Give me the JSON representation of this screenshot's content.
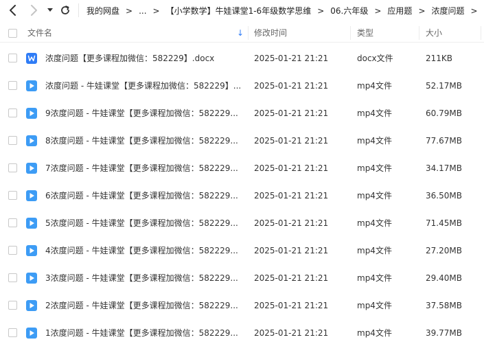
{
  "toolbar": {
    "back_icon": "chevron-left-icon",
    "forward_icon": "chevron-right-icon",
    "dropdown_icon": "caret-down-icon",
    "refresh_icon": "refresh-icon"
  },
  "breadcrumbs": [
    {
      "label": "我的网盘"
    },
    {
      "label": "..."
    },
    {
      "label": "【小学数学】牛娃课堂1-6年级数学思维"
    },
    {
      "label": "06.六年级"
    },
    {
      "label": "应用题"
    },
    {
      "label": "浓度问题"
    }
  ],
  "breadcrumb_separator": ">",
  "columns": {
    "name": "文件名",
    "sort_arrow": "↓",
    "date": "修改时间",
    "type": "类型",
    "size": "大小"
  },
  "colors": {
    "docx_icon": "#2f7cf6",
    "mp4_icon": "#3d9cf5",
    "sort_arrow": "#2f7cf6"
  },
  "files": [
    {
      "icon": "word-doc-icon",
      "name": "浓度问题【更多课程加微信：582229】.docx",
      "date": "2025-01-21 21:21",
      "type": "docx文件",
      "size": "211KB"
    },
    {
      "icon": "video-play-icon",
      "name": "浓度问题 - 牛娃课堂【更多课程加微信：582229】....",
      "date": "2025-01-21 21:21",
      "type": "mp4文件",
      "size": "52.17MB"
    },
    {
      "icon": "video-play-icon",
      "name": "9浓度问题 - 牛娃课堂【更多课程加微信：582229...",
      "date": "2025-01-21 21:21",
      "type": "mp4文件",
      "size": "60.79MB"
    },
    {
      "icon": "video-play-icon",
      "name": "8浓度问题 - 牛娃课堂【更多课程加微信：582229...",
      "date": "2025-01-21 21:21",
      "type": "mp4文件",
      "size": "77.67MB"
    },
    {
      "icon": "video-play-icon",
      "name": "7浓度问题 - 牛娃课堂【更多课程加微信：582229...",
      "date": "2025-01-21 21:21",
      "type": "mp4文件",
      "size": "34.17MB"
    },
    {
      "icon": "video-play-icon",
      "name": "6浓度问题 - 牛娃课堂【更多课程加微信：582229...",
      "date": "2025-01-21 21:21",
      "type": "mp4文件",
      "size": "36.50MB"
    },
    {
      "icon": "video-play-icon",
      "name": "5浓度问题 - 牛娃课堂【更多课程加微信：582229...",
      "date": "2025-01-21 21:21",
      "type": "mp4文件",
      "size": "71.45MB"
    },
    {
      "icon": "video-play-icon",
      "name": "4浓度问题 - 牛娃课堂【更多课程加微信：582229...",
      "date": "2025-01-21 21:21",
      "type": "mp4文件",
      "size": "27.20MB"
    },
    {
      "icon": "video-play-icon",
      "name": "3浓度问题 - 牛娃课堂【更多课程加微信：582229...",
      "date": "2025-01-21 21:21",
      "type": "mp4文件",
      "size": "29.40MB"
    },
    {
      "icon": "video-play-icon",
      "name": "2浓度问题 - 牛娃课堂【更多课程加微信：582229...",
      "date": "2025-01-21 21:21",
      "type": "mp4文件",
      "size": "37.58MB"
    },
    {
      "icon": "video-play-icon",
      "name": "1浓度问题 - 牛娃课堂【更多课程加微信：582229...",
      "date": "2025-01-21 21:21",
      "type": "mp4文件",
      "size": "39.77MB"
    }
  ]
}
